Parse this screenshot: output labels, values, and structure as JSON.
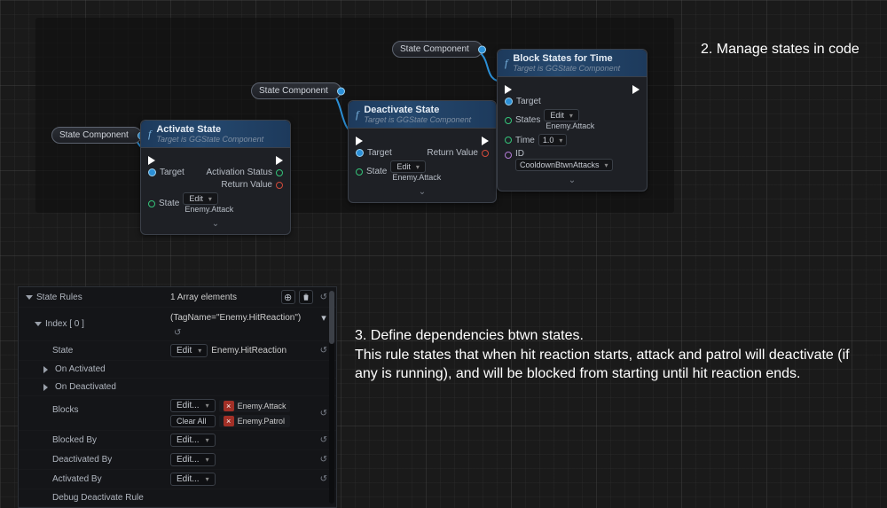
{
  "annotations": {
    "a1": "2. Manage states in code",
    "a2_l1": "3. Define dependencies btwn states.",
    "a2_l2": "This rule states that when hit reaction starts, attack and patrol will deactivate (if any is running), and will be blocked from starting until hit reaction ends."
  },
  "varNodeLabel": "State Component",
  "nodes": {
    "activate": {
      "title": "Activate State",
      "subtitle": "Target is GGState Component",
      "targetLabel": "Target",
      "stateLabel": "State",
      "editLabel": "Edit",
      "stateValue": "Enemy.Attack",
      "outA": "Activation Status",
      "outB": "Return Value"
    },
    "deactivate": {
      "title": "Deactivate State",
      "subtitle": "Target is GGState Component",
      "targetLabel": "Target",
      "stateLabel": "State",
      "editLabel": "Edit",
      "stateValue": "Enemy.Attack",
      "outA": "Return Value"
    },
    "block": {
      "title": "Block States for Time",
      "subtitle": "Target is GGState Component",
      "targetLabel": "Target",
      "statesLabel": "States",
      "editLabel": "Edit",
      "statesValue": "Enemy.Attack",
      "timeLabel": "Time",
      "timeValue": "1.0",
      "idLabel": "ID",
      "idValue": "CooldownBtwnAttacks"
    }
  },
  "panel": {
    "header": "State Rules",
    "arrayCount": "1 Array elements",
    "indexLabel": "Index [ 0 ]",
    "tagExpr": "(TagName=\"Enemy.HitReaction\")",
    "rows": {
      "state": "State",
      "stateVal": "Enemy.HitReaction",
      "onActivated": "On Activated",
      "onDeactivated": "On Deactivated",
      "blocks": "Blocks",
      "blockTag1": "Enemy.Attack",
      "blockTag2": "Enemy.Patrol",
      "clearAll": "Clear All",
      "blockedBy": "Blocked By",
      "deactivatedBy": "Deactivated By",
      "activatedBy": "Activated By",
      "debug": "Debug Deactivate Rule"
    },
    "editLabel": "Edit...",
    "editShort": "Edit"
  }
}
